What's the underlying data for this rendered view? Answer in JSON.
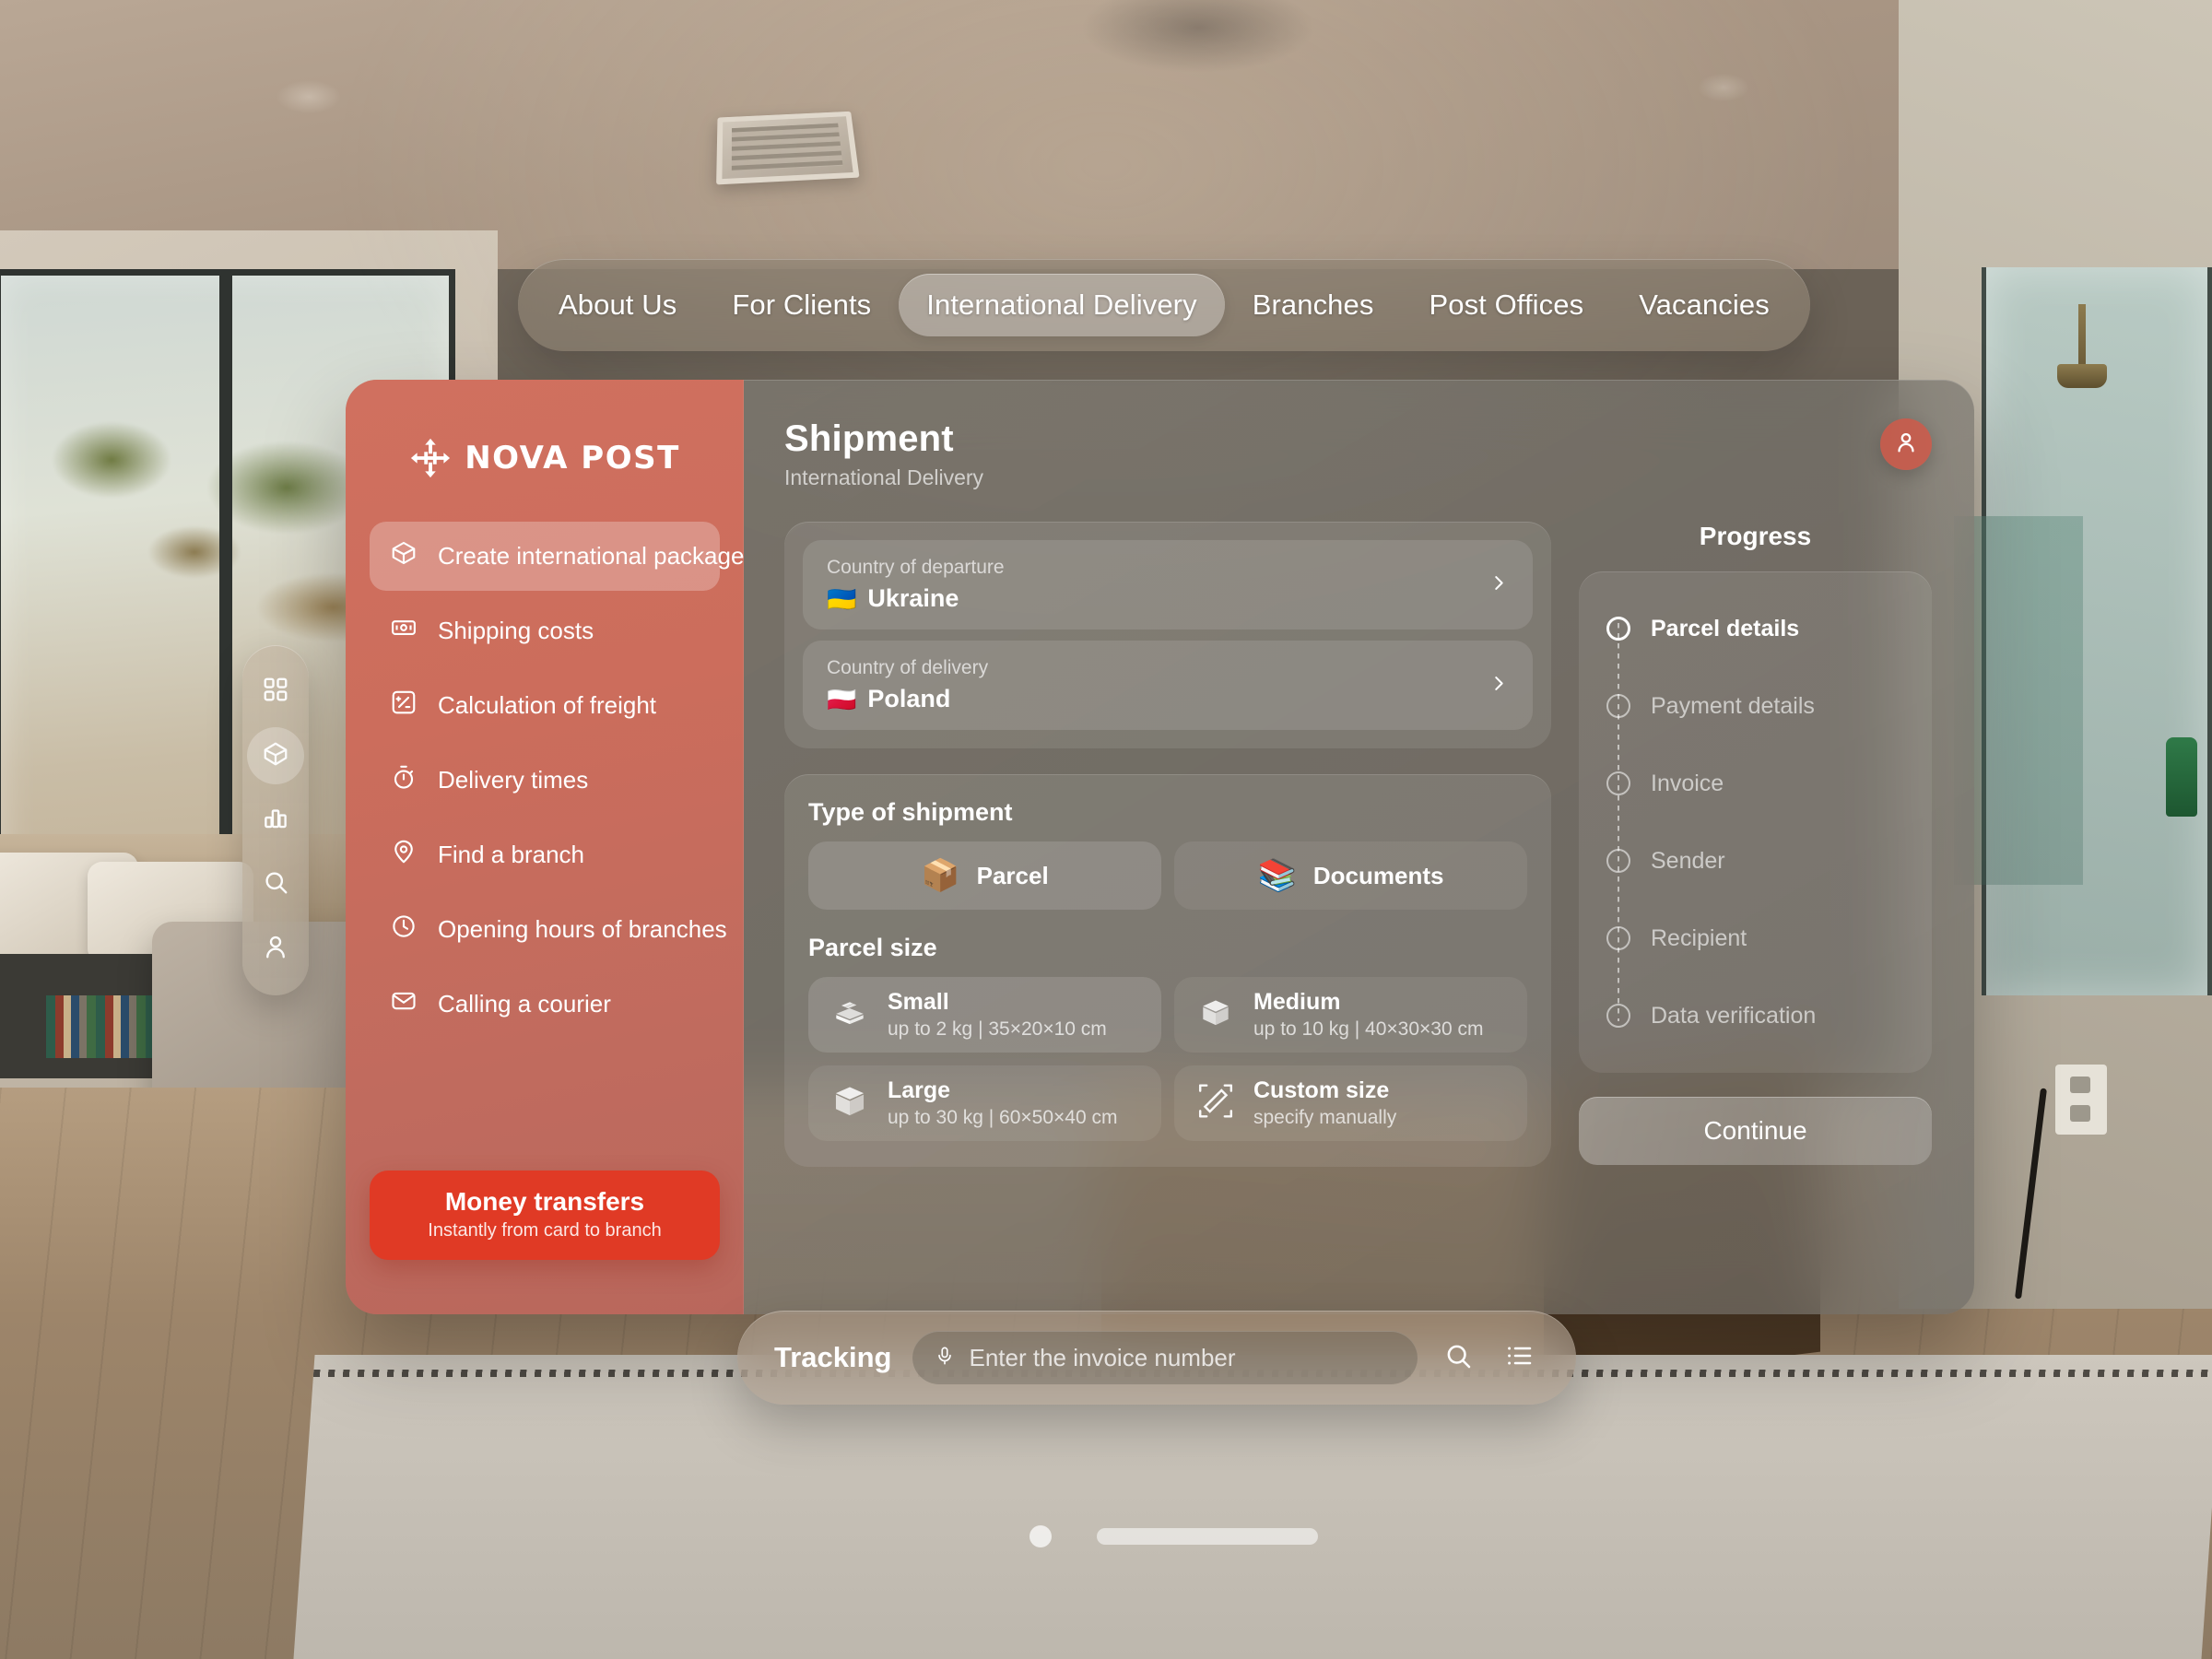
{
  "topnav": {
    "items": [
      {
        "label": "About Us",
        "active": false
      },
      {
        "label": "For Clients",
        "active": false
      },
      {
        "label": "International Delivery",
        "active": true
      },
      {
        "label": "Branches",
        "active": false
      },
      {
        "label": "Post Offices",
        "active": false
      },
      {
        "label": "Vacancies",
        "active": false
      }
    ]
  },
  "dock": {
    "items": [
      {
        "icon": "grid-icon",
        "active": false
      },
      {
        "icon": "package-icon",
        "active": true
      },
      {
        "icon": "bar-chart-icon",
        "active": false
      },
      {
        "icon": "search-icon",
        "active": false
      },
      {
        "icon": "person-icon",
        "active": false
      }
    ]
  },
  "sidebar": {
    "brand": "NOVA POST",
    "items": [
      {
        "label": "Create international package",
        "icon": "package-icon",
        "selected": true
      },
      {
        "label": "Shipping costs",
        "icon": "banknote-icon",
        "selected": false
      },
      {
        "label": "Calculation of freight",
        "icon": "calculator-icon",
        "selected": false
      },
      {
        "label": "Delivery times",
        "icon": "stopwatch-icon",
        "selected": false
      },
      {
        "label": "Find a branch",
        "icon": "map-pin-icon",
        "selected": false
      },
      {
        "label": "Opening hours of branches",
        "icon": "clock-icon",
        "selected": false
      },
      {
        "label": "Calling a courier",
        "icon": "envelope-icon",
        "selected": false
      }
    ],
    "money_transfers": {
      "title": "Money transfers",
      "subtitle": "Instantly from card to branch"
    }
  },
  "header": {
    "title": "Shipment",
    "subtitle": "International Delivery",
    "avatar_icon": "person-icon"
  },
  "route": {
    "departure": {
      "label": "Country of departure",
      "value": "Ukraine",
      "flag": "🇺🇦"
    },
    "delivery": {
      "label": "Country of delivery",
      "value": "Poland",
      "flag": "🇵🇱"
    },
    "chevron_icon": "chevron-right-icon"
  },
  "shipment": {
    "type_title": "Type of shipment",
    "types": [
      {
        "label": "Parcel",
        "icon": "parcel-box-emoji",
        "glyph": "📦",
        "selected": true
      },
      {
        "label": "Documents",
        "icon": "documents-emoji",
        "glyph": "📚",
        "selected": false
      }
    ],
    "size_title": "Parcel size",
    "sizes": [
      {
        "label": "Small",
        "detail": "up to 2 kg  |  35×20×10 cm",
        "icon": "box-small-icon",
        "selected": true
      },
      {
        "label": "Medium",
        "detail": "up to 10 kg  |  40×30×30 cm",
        "icon": "box-medium-icon",
        "selected": false
      },
      {
        "label": "Large",
        "detail": "up to 30 kg  |  60×50×40 cm",
        "icon": "box-large-icon",
        "selected": false
      },
      {
        "label": "Custom size",
        "detail": "specify manually",
        "icon": "ruler-icon",
        "selected": false
      }
    ]
  },
  "progress": {
    "title": "Progress",
    "steps": [
      {
        "label": "Parcel details",
        "current": true
      },
      {
        "label": "Payment details",
        "current": false
      },
      {
        "label": "Invoice",
        "current": false
      },
      {
        "label": "Sender",
        "current": false
      },
      {
        "label": "Recipient",
        "current": false
      },
      {
        "label": "Data verification",
        "current": false
      }
    ],
    "continue_label": "Continue"
  },
  "tracking": {
    "label": "Tracking",
    "placeholder": "Enter the invoice number",
    "value": "",
    "mic_icon": "microphone-icon",
    "search_icon": "search-icon",
    "list_icon": "list-icon"
  },
  "colors": {
    "brand_red": "#cc6d5c",
    "accent_red": "#e03a25",
    "avatar_red": "#cc5a4a",
    "glass": "rgba(255,255,255,0.12)"
  }
}
